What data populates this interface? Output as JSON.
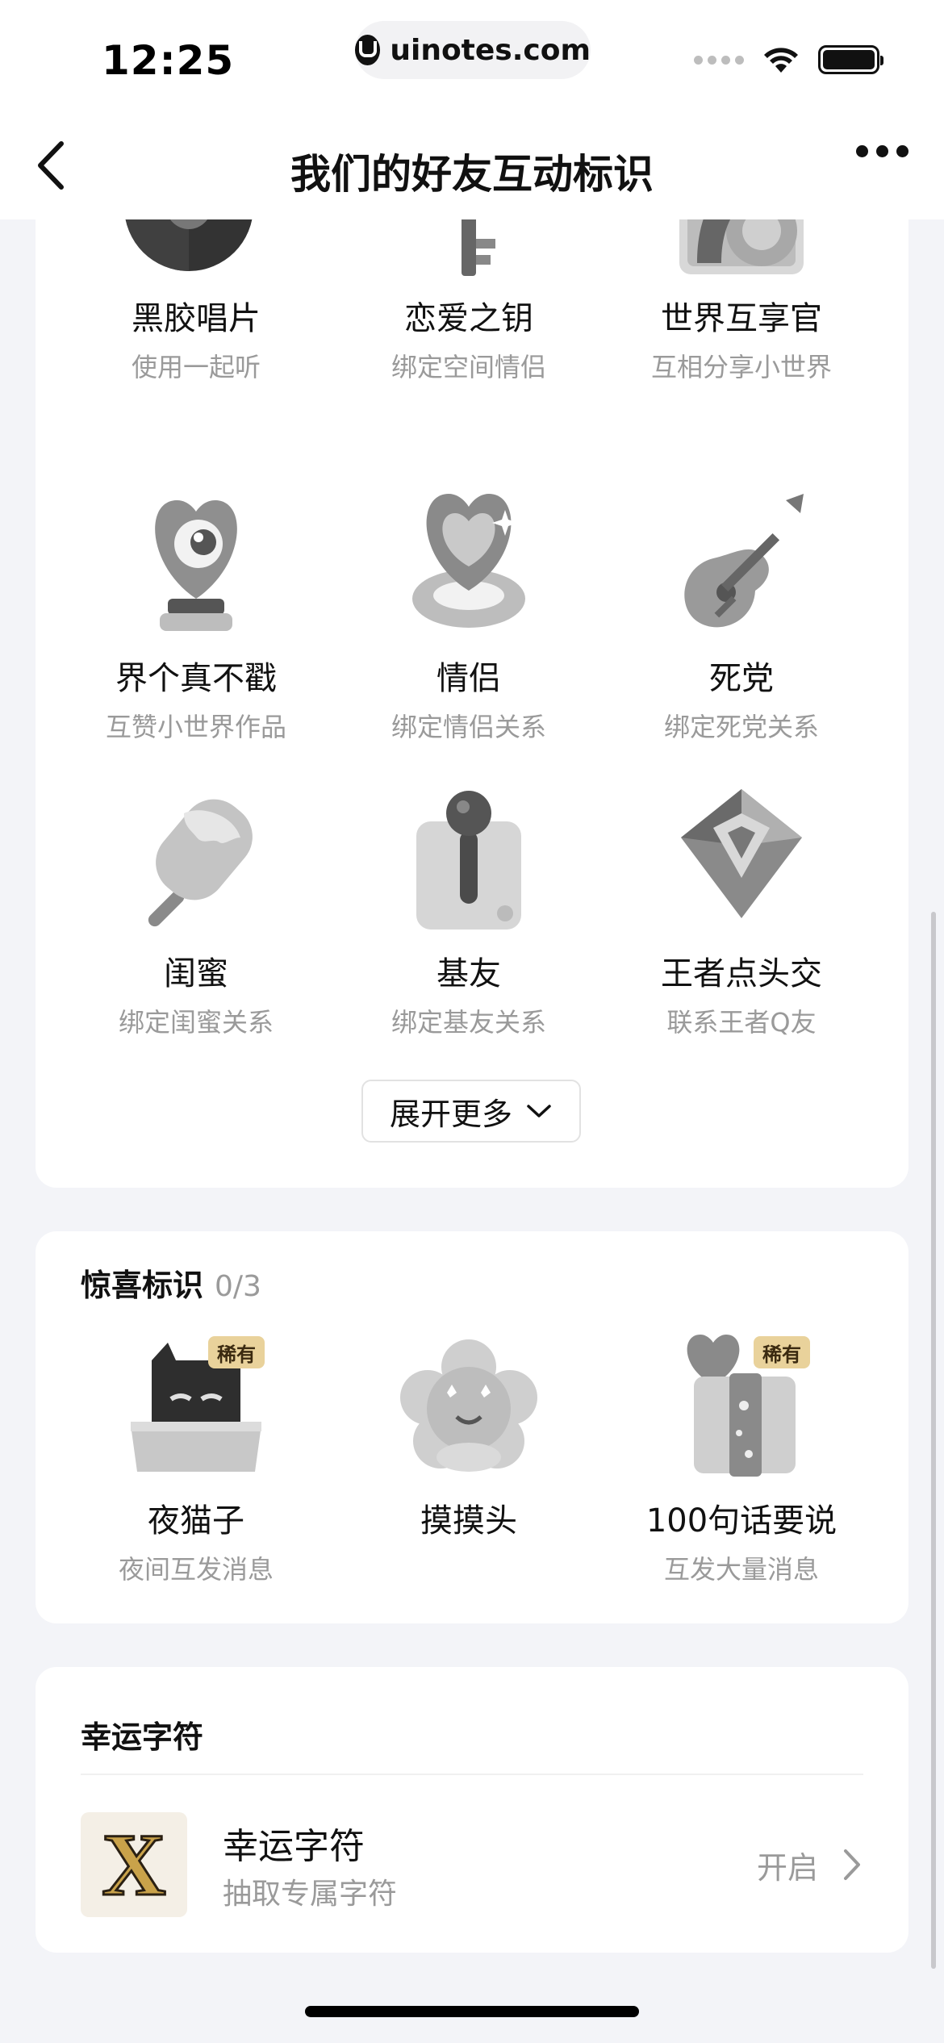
{
  "status_bar": {
    "time": "12:25",
    "url": "uinotes.com"
  },
  "nav": {
    "title": "我们的好友互动标识"
  },
  "badges": [
    {
      "title": "黑胶唱片",
      "subtitle": "使用一起听",
      "icon": "vinyl-record-icon"
    },
    {
      "title": "恋爱之钥",
      "subtitle": "绑定空间情侣",
      "icon": "heart-key-icon"
    },
    {
      "title": "世界互享官",
      "subtitle": "互相分享小世界",
      "icon": "world-share-icon"
    },
    {
      "title": "界个真不戳",
      "subtitle": "互赞小世界作品",
      "icon": "heart-trophy-icon"
    },
    {
      "title": "情侣",
      "subtitle": "绑定情侣关系",
      "icon": "heart-ring-icon"
    },
    {
      "title": "死党",
      "subtitle": "绑定死党关系",
      "icon": "guitar-icon"
    },
    {
      "title": "闺蜜",
      "subtitle": "绑定闺蜜关系",
      "icon": "popsicle-icon"
    },
    {
      "title": "基友",
      "subtitle": "绑定基友关系",
      "icon": "joystick-icon"
    },
    {
      "title": "王者点头交",
      "subtitle": "联系王者Q友",
      "icon": "diamond-icon"
    }
  ],
  "expand_label": "展开更多",
  "surprise": {
    "title": "惊喜标识",
    "count": "0/3",
    "rare_label": "稀有",
    "items": [
      {
        "title": "夜猫子",
        "subtitle": "夜间互发消息",
        "icon": "night-cat-icon",
        "rare": true
      },
      {
        "title": "摸摸头",
        "subtitle": "",
        "icon": "pat-head-flower-icon",
        "rare": false
      },
      {
        "title": "100句话要说",
        "subtitle": "互发大量消息",
        "icon": "heart-gift-icon",
        "rare": true
      }
    ]
  },
  "lucky": {
    "section_title": "幸运字符",
    "item_name": "幸运字符",
    "item_desc": "抽取专属字符",
    "action_label": "开启",
    "thumb_letter": "X"
  }
}
